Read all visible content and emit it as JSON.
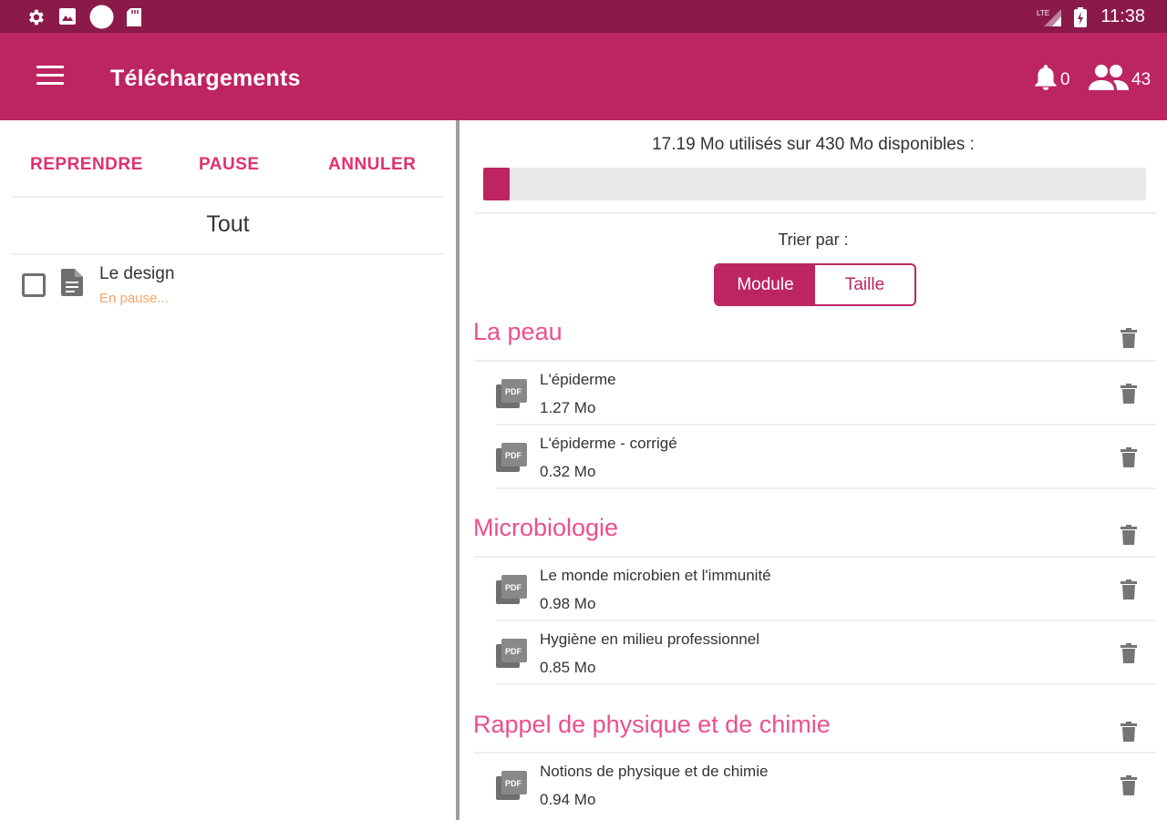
{
  "status_bar": {
    "time": "11:38",
    "icons": [
      "settings-icon",
      "photo-icon",
      "circle-icon",
      "sd-card-icon",
      "signal-icon",
      "battery-icon"
    ]
  },
  "app_bar": {
    "title": "Téléchargements",
    "notifications_count": "0",
    "users_count": "43"
  },
  "downloads_panel": {
    "resume_label": "REPRENDRE",
    "pause_label": "PAUSE",
    "cancel_label": "ANNULER",
    "filter_label": "Tout",
    "items": [
      {
        "name": "Le design",
        "status": "En pause..."
      }
    ]
  },
  "storage": {
    "text": "17.19 Mo utilisés sur 430 Mo disponibles :",
    "used_fraction": 0.04
  },
  "sort": {
    "label": "Trier par :",
    "options": [
      "Module",
      "Taille"
    ],
    "selected": "Module"
  },
  "modules": [
    {
      "title": "La peau",
      "files": [
        {
          "name": "L'épiderme",
          "size": "1.27 Mo"
        },
        {
          "name": "L'épiderme - corrigé",
          "size": "0.32 Mo"
        }
      ]
    },
    {
      "title": "Microbiologie",
      "files": [
        {
          "name": "Le monde microbien et l'immunité",
          "size": "0.98 Mo"
        },
        {
          "name": "Hygiène en milieu professionnel",
          "size": "0.85 Mo"
        }
      ]
    },
    {
      "title": "Rappel de physique et de chimie",
      "files": [
        {
          "name": "Notions de physique et de chimie",
          "size": "0.94 Mo"
        }
      ]
    }
  ],
  "colors": {
    "status_bar": "#8b1a4b",
    "app_bar": "#bd2462",
    "accent": "#e0316f",
    "module_title": "#ec4f8c",
    "paused_status": "#f5a36b"
  }
}
